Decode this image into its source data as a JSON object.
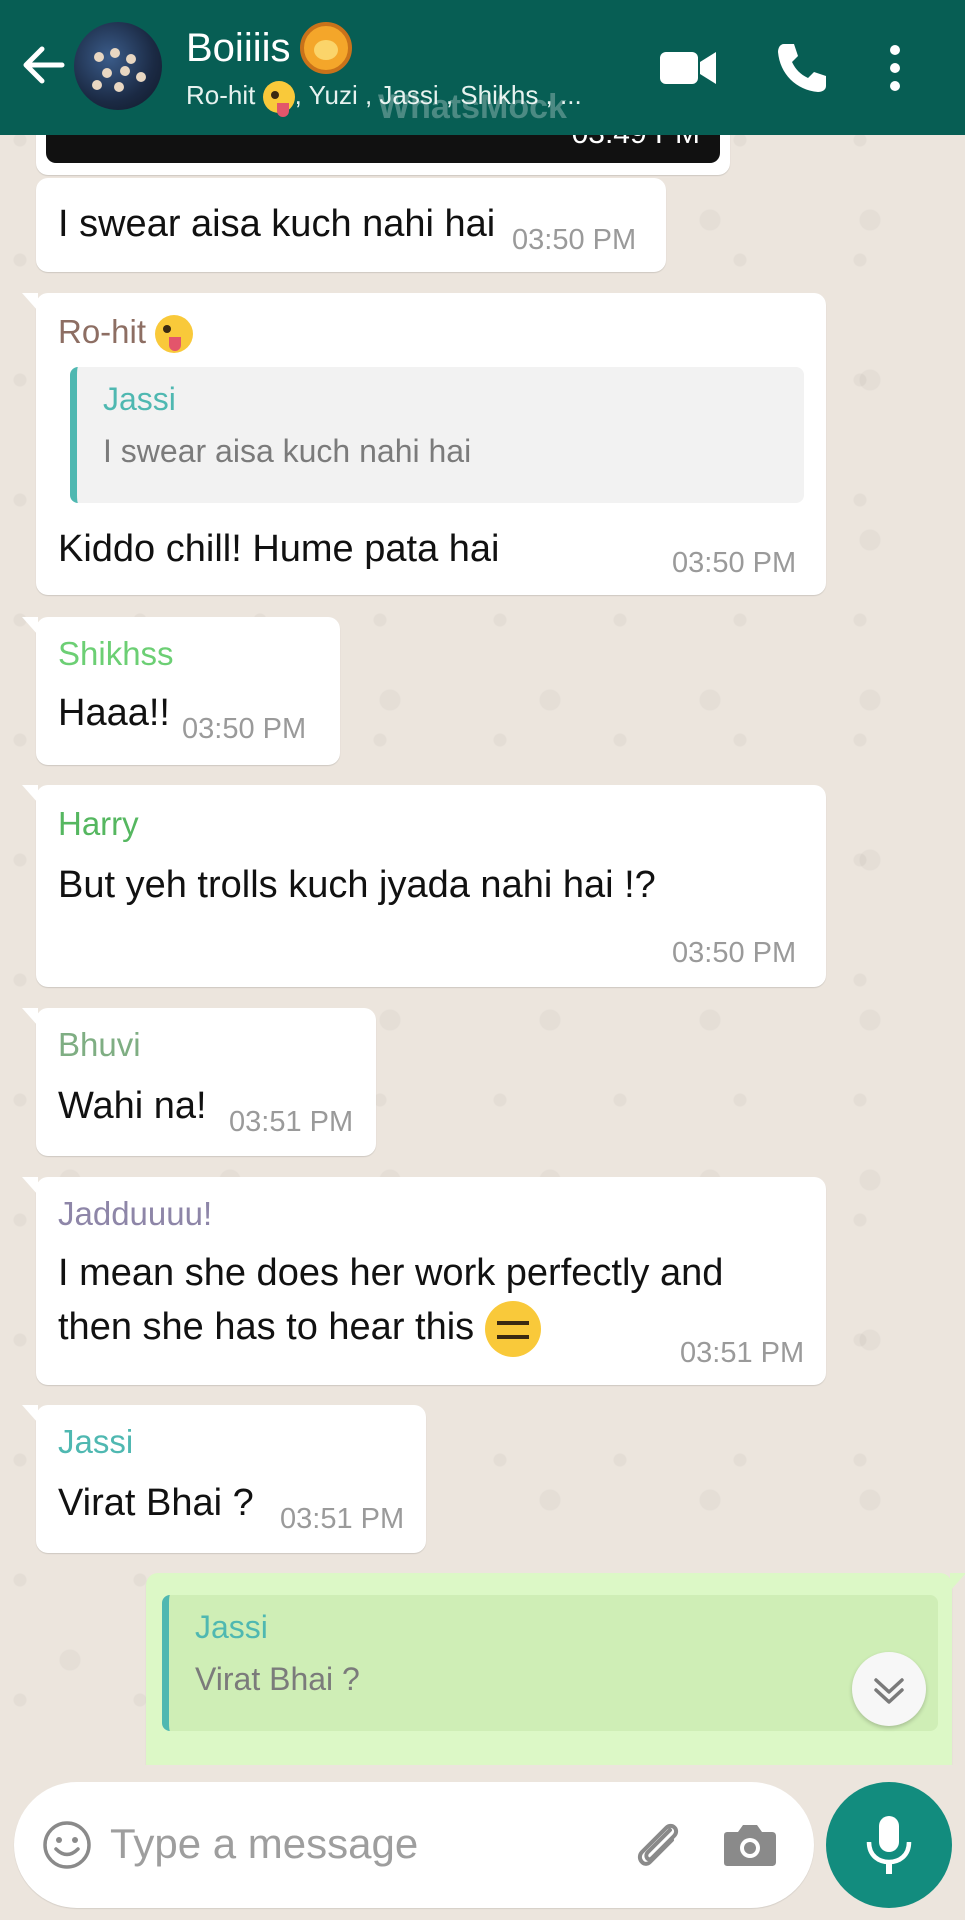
{
  "header": {
    "group_name": "Boiiiis",
    "members_prefix": "Ro-hit",
    "members_rest": ", Yuzi , Jassi , Shikhs , ...",
    "watermark": "WhatsMock"
  },
  "top_partial_time": "03:49 PM",
  "messages": [
    {
      "text": "I swear aisa kuch nahi hai",
      "time": "03:50 PM"
    },
    {
      "sender": "Ro-hit",
      "sender_color": "#8d6e63",
      "reply_to_name": "Jassi",
      "reply_to_text": "I swear aisa kuch nahi hai",
      "text": "Kiddo chill! Hume pata hai",
      "time": "03:50 PM"
    },
    {
      "sender": "Shikhss",
      "sender_color": "#6ccf74",
      "text": "Haaa!!",
      "time": "03:50 PM"
    },
    {
      "sender": "Harry",
      "sender_color": "#55b760",
      "text": "But yeh trolls kuch jyada nahi hai !?",
      "time": "03:50 PM"
    },
    {
      "sender": "Bhuvi",
      "sender_color": "#7fae83",
      "text": "Wahi na!",
      "time": "03:51 PM"
    },
    {
      "sender": "Jadduuuu!",
      "sender_color": "#8e86a8",
      "text_line1": "I mean she does her work perfectly and",
      "text_line2": "then she has to hear this",
      "time": "03:51 PM"
    },
    {
      "sender": "Jassi",
      "sender_color": "#4fb8b1",
      "text": "Virat Bhai ?",
      "time": "03:51 PM"
    },
    {
      "reply_to_name": "Jassi",
      "reply_to_text": "Virat Bhai ?"
    }
  ],
  "composer": {
    "placeholder": "Type a message"
  },
  "colors": {
    "header": "#075e54",
    "outgoing": "#dcf8c6",
    "mic": "#128c7e"
  },
  "icons": [
    "back-arrow-icon",
    "video-call-icon",
    "phone-icon",
    "more-options-icon",
    "emoji-icon",
    "attach-icon",
    "camera-icon",
    "mic-icon",
    "chevron-down-icon"
  ]
}
